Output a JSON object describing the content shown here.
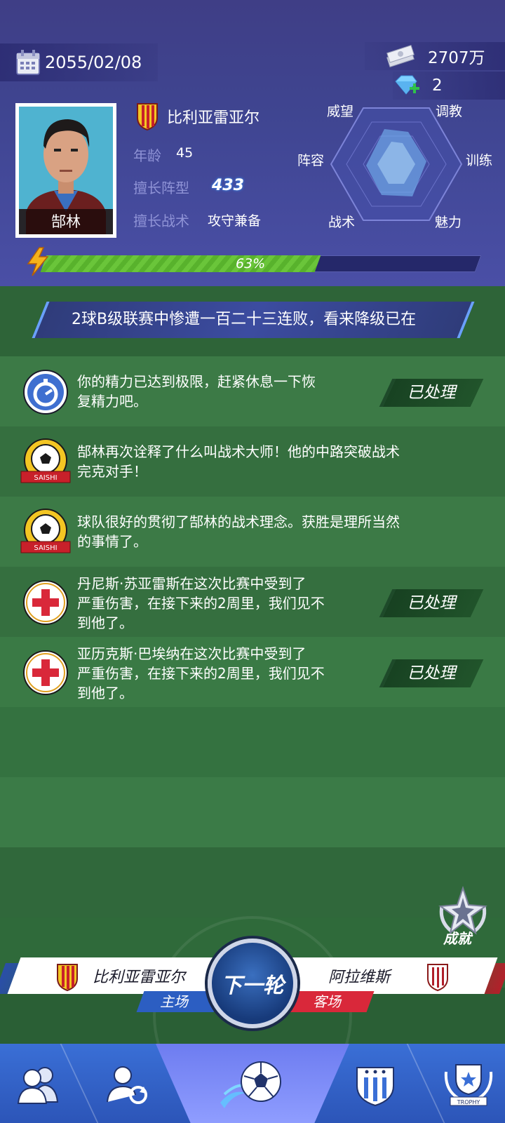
{
  "header": {
    "date": "2055/02/08",
    "money": "2707万",
    "gems": "2",
    "coach_name": "郜林",
    "club_name": "比利亚雷亚尔",
    "age_label": "年龄",
    "age_value": "45",
    "formation_label": "擅长阵型",
    "formation_value": "433",
    "tactic_label": "擅长战术",
    "tactic_value": "攻守兼备",
    "progress_text": "63%",
    "progress_value": 0.63
  },
  "hexagon": {
    "labels": [
      "威望",
      "调教",
      "阵容",
      "训练",
      "战术",
      "魅力"
    ]
  },
  "ticker": {
    "text": "2球B级联赛中惨遭一百二十三连败，看来降级已在"
  },
  "messages": [
    {
      "icon": "stopwatch-icon",
      "line1": "你的精力已达到极限，赶紧休息一下恢",
      "line2": "复精力吧。",
      "line3": "",
      "status": "已处理"
    },
    {
      "icon": "soccer-ball-badge-icon",
      "badge": "SAISHI",
      "line1": "郜林再次诠释了什么叫战术大师！他的中路突破战术",
      "line2": "完克对手！",
      "line3": "",
      "status": ""
    },
    {
      "icon": "soccer-ball-badge-icon",
      "badge": "SAISHI",
      "line1": "球队很好的贯彻了郜林的战术理念。获胜是理所当然",
      "line2": "的事情了。",
      "line3": "",
      "status": ""
    },
    {
      "icon": "red-cross-icon",
      "line1": "丹尼斯·苏亚雷斯在这次比赛中受到了",
      "line2": "严重伤害，在接下来的2周里，我们见不",
      "line3": "到他了。",
      "status": "已处理"
    },
    {
      "icon": "red-cross-icon",
      "line1": "亚历克斯·巴埃纳在这次比赛中受到了",
      "line2": "严重伤害，在接下来的2周里，我们见不",
      "line3": "到他了。",
      "status": "已处理"
    }
  ],
  "match": {
    "home_team": "比利亚雷亚尔",
    "home_tag": "主场",
    "away_team": "阿拉维斯",
    "away_tag": "客场",
    "next_label": "下一轮"
  },
  "achievement_label": "成就",
  "nav": {
    "trophy_text": "TROPHY"
  },
  "colors": {
    "header_bg": "#3f4591",
    "field_green": "#2f6a3a",
    "progress_green": "#6ac53a",
    "home_blue": "#2c5ec2",
    "away_red": "#d9283a"
  }
}
